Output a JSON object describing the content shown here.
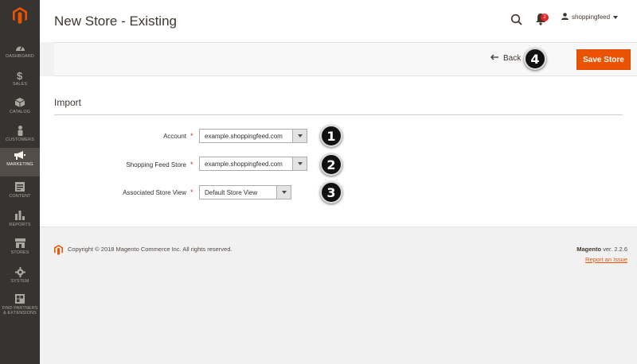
{
  "colors": {
    "accent": "#eb5202",
    "sidebar": "#373330",
    "sidebar_active": "#524d49",
    "badge": "#e22626"
  },
  "sidebar": {
    "logo": "magento-logo",
    "items": [
      {
        "label": "DASHBOARD",
        "icon": "speedometer-icon"
      },
      {
        "label": "SALES",
        "icon": "dollar-icon"
      },
      {
        "label": "CATALOG",
        "icon": "box-icon"
      },
      {
        "label": "CUSTOMERS",
        "icon": "person-icon"
      },
      {
        "label": "MARKETING",
        "icon": "megaphone-icon",
        "active": true
      },
      {
        "label": "CONTENT",
        "icon": "layout-icon"
      },
      {
        "label": "REPORTS",
        "icon": "bar-chart-icon"
      },
      {
        "label": "STORES",
        "icon": "storefront-icon"
      },
      {
        "label": "SYSTEM",
        "icon": "gear-icon"
      },
      {
        "label": "FIND PARTNERS & EXTENSIONS",
        "icon": "extensions-icon"
      }
    ]
  },
  "header": {
    "title": "New Store - Existing",
    "notifications_count": "2",
    "username": "shoppingfeed"
  },
  "toolbar": {
    "back_label": "Back",
    "save_label": "Save Store"
  },
  "form": {
    "section_title": "Import",
    "fields": [
      {
        "label": "Account",
        "value": "example.shoppingfeed.com"
      },
      {
        "label": "Shopping Feed Store",
        "value": "example.shoppingfeed.com"
      },
      {
        "label": "Associated Store View",
        "value": "Default Store View"
      }
    ]
  },
  "steps": [
    "1",
    "2",
    "3",
    "4"
  ],
  "footer": {
    "copyright": "Copyright © 2018 Magento Commerce Inc. All rights reserved.",
    "brand": "Magento",
    "version": "ver. 2.2.6",
    "report_link": "Report an Issue"
  }
}
